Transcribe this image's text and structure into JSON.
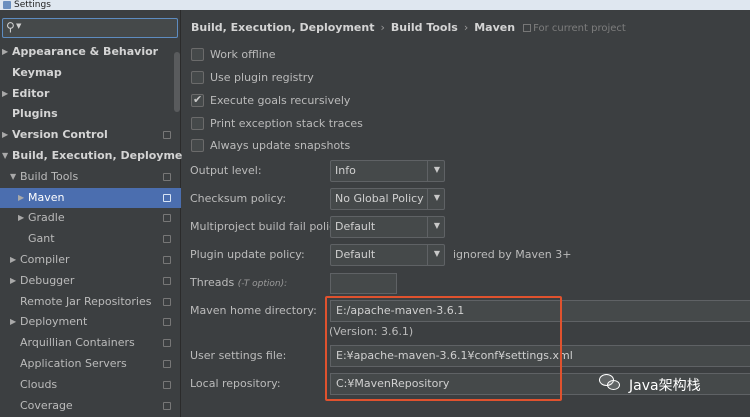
{
  "window": {
    "title": "Settings"
  },
  "sidebar": {
    "search_placeholder": "",
    "items": [
      {
        "label": "Appearance & Behavior",
        "arrow": "▶",
        "bold": true
      },
      {
        "label": "Keymap",
        "arrow": "",
        "bold": true
      },
      {
        "label": "Editor",
        "arrow": "▶",
        "bold": true
      },
      {
        "label": "Plugins",
        "arrow": "",
        "bold": true
      },
      {
        "label": "Version Control",
        "arrow": "▶",
        "bold": true
      },
      {
        "label": "Build, Execution, Deployment",
        "arrow": "▼",
        "bold": true
      },
      {
        "label": "Build Tools",
        "arrow": "▼",
        "bold": false
      },
      {
        "label": "Maven",
        "arrow": "▶",
        "bold": false,
        "selected": true
      },
      {
        "label": "Gradle",
        "arrow": "▶",
        "bold": false
      },
      {
        "label": "Gant",
        "arrow": "",
        "bold": false
      },
      {
        "label": "Compiler",
        "arrow": "▶",
        "bold": false
      },
      {
        "label": "Debugger",
        "arrow": "▶",
        "bold": false
      },
      {
        "label": "Remote Jar Repositories",
        "arrow": "",
        "bold": false
      },
      {
        "label": "Deployment",
        "arrow": "▶",
        "bold": false
      },
      {
        "label": "Arquillian Containers",
        "arrow": "",
        "bold": false
      },
      {
        "label": "Application Servers",
        "arrow": "",
        "bold": false
      },
      {
        "label": "Clouds",
        "arrow": "",
        "bold": false
      },
      {
        "label": "Coverage",
        "arrow": "",
        "bold": false
      }
    ]
  },
  "breadcrumb": {
    "items": [
      "Build, Execution, Deployment",
      "Build Tools",
      "Maven"
    ],
    "separator": "›",
    "scope": "For current project"
  },
  "checkboxes": [
    {
      "label": "Work offline",
      "checked": false
    },
    {
      "label": "Use plugin registry",
      "checked": false
    },
    {
      "label": "Execute goals recursively",
      "checked": true
    },
    {
      "label": "Print exception stack traces",
      "checked": false
    },
    {
      "label": "Always update snapshots",
      "checked": false
    }
  ],
  "form": {
    "output_level": {
      "label": "Output level:",
      "value": "Info"
    },
    "checksum_policy": {
      "label": "Checksum policy:",
      "value": "No Global Policy"
    },
    "multiproject_fail_policy": {
      "label": "Multiproject build fail policy:",
      "value": "Default"
    },
    "plugin_update_policy": {
      "label": "Plugin update policy:",
      "value": "Default",
      "note": "ignored by Maven 3+"
    },
    "threads": {
      "label": "Threads",
      "hint": "(-T option):",
      "value": ""
    },
    "maven_home": {
      "label": "Maven home directory:",
      "value": "E:/apache-maven-3.6.1",
      "version": "(Version: 3.6.1)"
    },
    "user_settings": {
      "label": "User settings file:",
      "value": "E:¥apache-maven-3.6.1¥conf¥settings.xml"
    },
    "local_repository": {
      "label": "Local repository:",
      "value": "C:¥MavenRepository"
    }
  },
  "watermark": {
    "label": "Java架构栈"
  },
  "colors": {
    "selection": "#4b6eaf",
    "highlight_box": "#e0522e",
    "background": "#3c3f41"
  }
}
